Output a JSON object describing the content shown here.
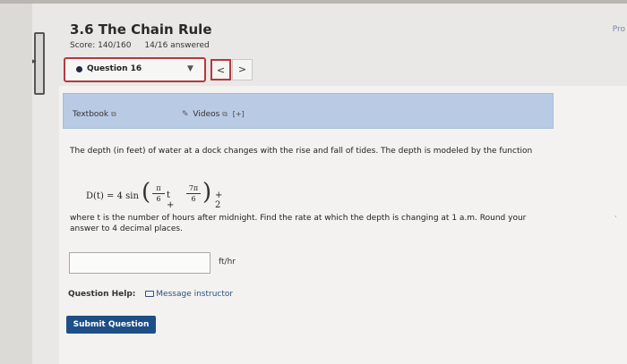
{
  "header": {
    "title": "3.6 The Chain Rule",
    "score": "Score: 140/160",
    "answered": "14/16 answered",
    "corner_link": "Pro"
  },
  "question_nav": {
    "selected": "Question 16",
    "prev_symbol": "<",
    "next_symbol": ">"
  },
  "resources": {
    "textbook_label": "Textbook",
    "videos_label": "Videos",
    "videos_badge": "[+]"
  },
  "problem": {
    "intro": "The depth (in feet) of water at a dock changes with the rise and fall of tides. The depth is modeled by the function",
    "formula": {
      "lhs": "D(t) = 4 sin",
      "frac1_num": "π",
      "frac1_den": "6",
      "var": "t +",
      "frac2_num": "7π",
      "frac2_den": "6",
      "tail": "+ 2"
    },
    "instructions": "where t is the number of hours after midnight. Find the rate at which the depth is changing at 1 a.m. Round your answer to 4 decimal places.",
    "answer_value": "",
    "unit": "ft/hr"
  },
  "help": {
    "label": "Question Help:",
    "message_link": "Message instructor"
  },
  "actions": {
    "submit_label": "Submit Question"
  }
}
